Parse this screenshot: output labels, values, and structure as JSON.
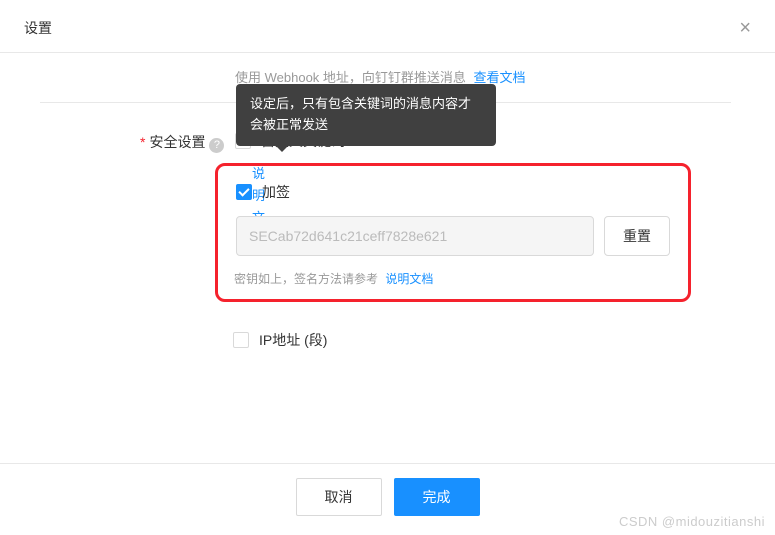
{
  "dialog": {
    "title": "设置",
    "close_icon": "×"
  },
  "hint": {
    "text": "使用 Webhook 地址，向钉钉群推送消息",
    "link": "查看文档"
  },
  "tooltip": {
    "text": "设定后，只有包含关键词的消息内容才会被正常发送"
  },
  "security": {
    "required_mark": "*",
    "label": "安全设置",
    "help_icon": "question-icon",
    "doc_link": "说明文档",
    "options": {
      "custom_keyword": {
        "label": "自定义关键词",
        "checked": false
      },
      "sign": {
        "label": "加签",
        "checked": true,
        "secret_value": "SECab72d641c21ceff7828e621",
        "reset_label": "重置",
        "secret_hint": "密钥如上，签名方法请参考",
        "secret_hint_link": "说明文档"
      },
      "ip": {
        "label": "IP地址 (段)",
        "checked": false
      }
    }
  },
  "footer": {
    "cancel": "取消",
    "confirm": "完成"
  },
  "watermark": "CSDN @midouzitianshi"
}
